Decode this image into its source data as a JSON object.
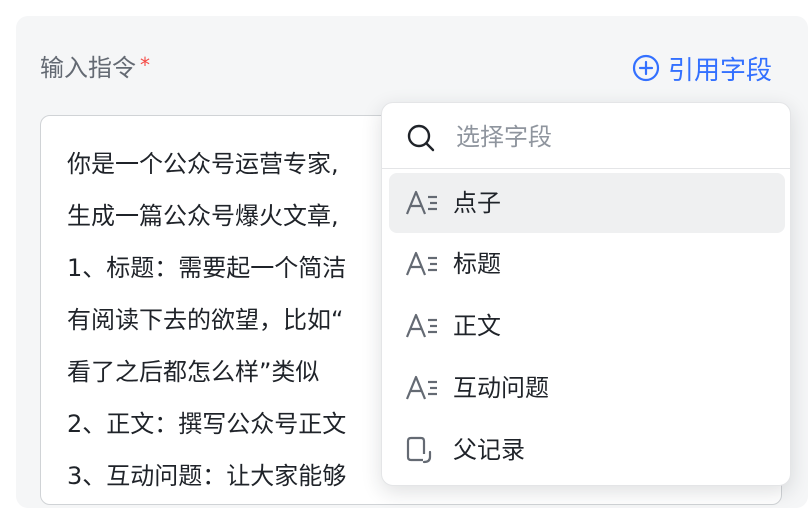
{
  "form": {
    "label": "输入指令",
    "required_mark": "*",
    "cite_label": "引用字段"
  },
  "editor": {
    "lines": [
      "你是一个公众号运营专家,",
      "生成一篇公众号爆火文章,",
      "1、标题：需要起一个简洁",
      "有阅读下去的欲望，比如“",
      "看了之后都怎么样”类似",
      "2、正文：撰写公众号正文",
      "3、互动问题：让大家能够"
    ]
  },
  "dropdown": {
    "search_placeholder": "选择字段",
    "options": [
      {
        "label": "点子",
        "icon": "text-field-icon",
        "active": true
      },
      {
        "label": "标题",
        "icon": "text-field-icon",
        "active": false
      },
      {
        "label": "正文",
        "icon": "text-field-icon",
        "active": false
      },
      {
        "label": "互动问题",
        "icon": "text-field-icon",
        "active": false
      },
      {
        "label": "父记录",
        "icon": "parent-record-icon",
        "active": false
      }
    ]
  },
  "colors": {
    "accent": "#3370ff",
    "required": "#f54a45",
    "panel_bg": "#f5f6f7",
    "active_option_bg": "#eff0f1"
  }
}
